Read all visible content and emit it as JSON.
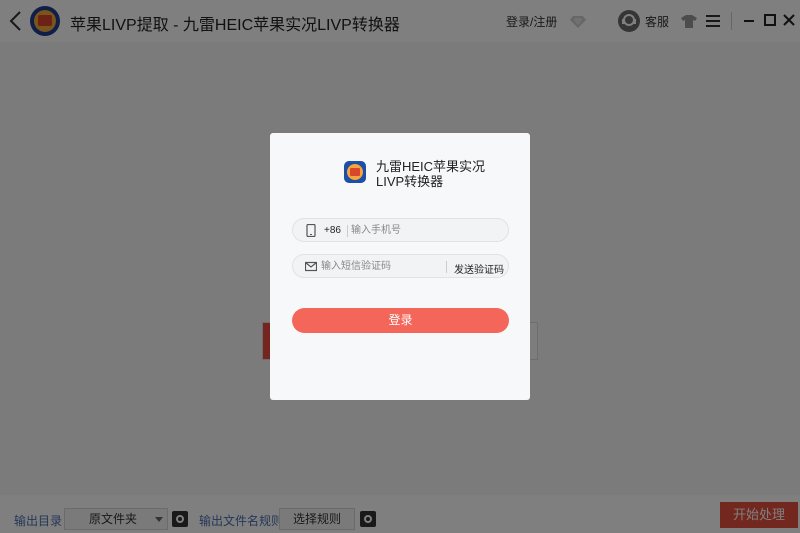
{
  "titlebar": {
    "app_title": "苹果LIVP提取 - 九雷HEIC苹果实况LIVP转换器",
    "login_register": "登录/注册",
    "service_label": "客服"
  },
  "bottombar": {
    "output_dir_label": "输出目录",
    "output_dir_value": "原文件夹",
    "file_name_rule_label": "输出文件名规则",
    "select_rule_button": "选择规则",
    "start_button": "开始处理"
  },
  "login_modal": {
    "app_name": "九雷HEIC苹果实况LIVP转换器",
    "country_code": "+86",
    "phone_placeholder": "输入手机号",
    "code_placeholder": "输入短信验证码",
    "send_code_label": "发送验证码",
    "login_button": "登录"
  },
  "colors": {
    "accent_red": "#e7503e",
    "login_button": "#f4665a",
    "link_blue": "#4a6fb0",
    "overlay": "rgba(0,0,0,0.5)"
  },
  "icons": [
    "back-icon",
    "app-logo-icon",
    "vip-diamond-icon",
    "customer-service-icon",
    "skin-shirt-icon",
    "menu-icon",
    "minimize-icon",
    "maximize-icon",
    "close-icon",
    "gear-icon",
    "phone-icon",
    "mail-icon"
  ]
}
